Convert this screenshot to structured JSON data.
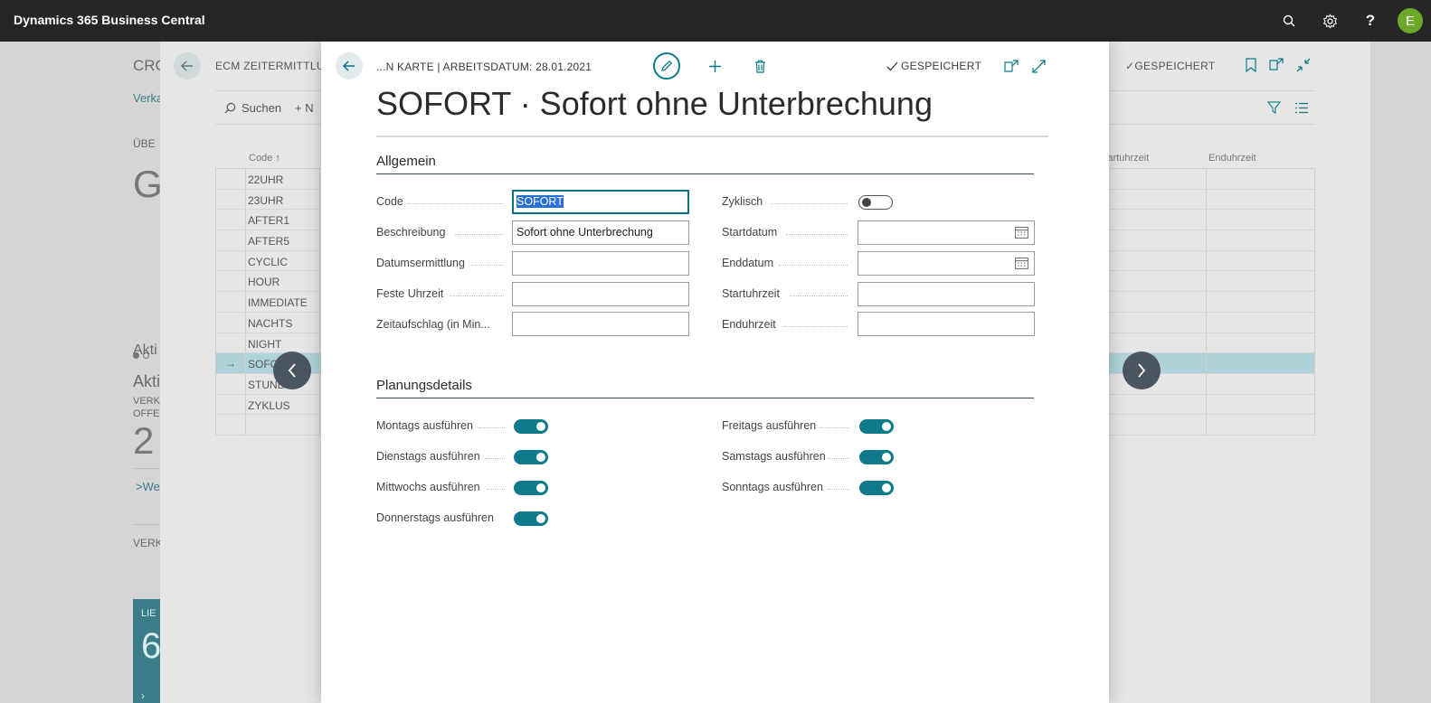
{
  "app": {
    "title": "Dynamics 365 Business Central",
    "user_initial": "E"
  },
  "background": {
    "crumb_fragment": "CRO",
    "nav_fragment": "Verka",
    "overview_fragment": "ÜBE",
    "big_fragment": "G",
    "activities_fragment": "Akti",
    "activities_sub_fragment": "Akti",
    "cue_label_1": "VERK",
    "cue_label_2": "OFFE",
    "cue_value": "2",
    "more_fragment": "Wei",
    "section_fragment": "VERK",
    "tile_label": "LIE",
    "tile_value": "6"
  },
  "list_page": {
    "title": "ECM ZEITERMITTLUN",
    "saved_label": "GESPEICHERT",
    "search_label": "Suchen",
    "new_label": "N",
    "columns": {
      "code": "Code ↑",
      "start_time": "Startuhrzeit",
      "end_time": "Enduhrzeit"
    },
    "rows": [
      "22UHR",
      "23UHR",
      "AFTER1",
      "AFTER5",
      "CYCLIC",
      "HOUR",
      "IMMEDIATE",
      "NACHTS",
      "NIGHT",
      "SOFO",
      "STUND",
      "ZYKLUS",
      ""
    ],
    "selected_row": "SOFO"
  },
  "card": {
    "breadcrumb": "...N KARTE | ARBEITSDATUM: 28.01.2021",
    "saved_label": "GESPEICHERT",
    "title": "SOFORT · Sofort ohne Unterbrechung",
    "general": {
      "title": "Allgemein",
      "code_label": "Code",
      "code_value": "SOFORT",
      "description_label": "Beschreibung",
      "description_value": "Sofort ohne Unterbrechung",
      "date_calc_label": "Datumsermittlung",
      "date_calc_value": "",
      "fixed_time_label": "Feste Uhrzeit",
      "fixed_time_value": "",
      "time_surcharge_label": "Zeitaufschlag (in Min...",
      "time_surcharge_value": "",
      "cyclic_label": "Zyklisch",
      "cyclic_on": false,
      "start_date_label": "Startdatum",
      "start_date_value": "",
      "end_date_label": "Enddatum",
      "end_date_value": "",
      "start_time_label": "Startuhrzeit",
      "start_time_value": "",
      "end_time_label": "Enduhrzeit",
      "end_time_value": ""
    },
    "planning": {
      "title": "Planungsdetails",
      "monday_label": "Montags ausführen",
      "tuesday_label": "Dienstags ausführen",
      "wednesday_label": "Mittwochs ausführen",
      "thursday_label": "Donnerstags ausführen",
      "friday_label": "Freitags ausführen",
      "saturday_label": "Samstags ausführen",
      "sunday_label": "Sonntags ausführen",
      "monday_on": true,
      "tuesday_on": true,
      "wednesday_on": true,
      "thursday_on": true,
      "friday_on": true,
      "saturday_on": true,
      "sunday_on": true
    }
  },
  "colors": {
    "accent": "#0f7a8a",
    "appbar": "#262626",
    "selected_row": "#aed3da",
    "avatar": "#6ea829"
  },
  "icons": [
    "search-icon",
    "gear-icon",
    "help-icon",
    "back-arrow-icon",
    "pencil-icon",
    "plus-icon",
    "trash-icon",
    "checkmark-icon",
    "open-new-window-icon",
    "expand-icon",
    "collapse-icon",
    "bookmark-icon",
    "filter-icon",
    "list-icon",
    "calendar-icon",
    "chevron-left-icon",
    "chevron-right-icon"
  ]
}
